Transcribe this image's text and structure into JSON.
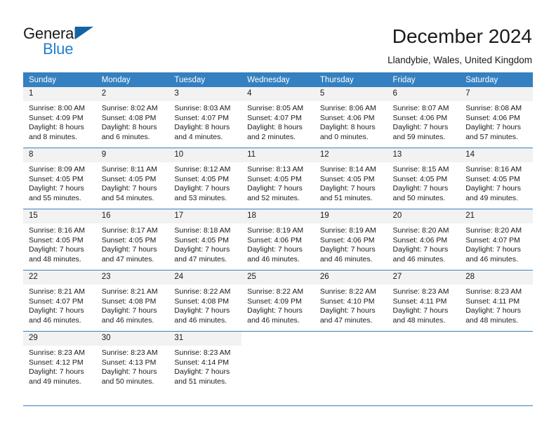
{
  "brand": {
    "line1": "General",
    "line2": "Blue",
    "flag_color": "#1464a5",
    "line2_color": "#1f7fd0"
  },
  "header": {
    "title": "December 2024",
    "subtitle": "Llandybie, Wales, United Kingdom"
  },
  "calendar": {
    "header_bg": "#3580c0",
    "daynum_bg": "#f2f2f2",
    "weekday_headers": [
      "Sunday",
      "Monday",
      "Tuesday",
      "Wednesday",
      "Thursday",
      "Friday",
      "Saturday"
    ],
    "weeks": [
      [
        {
          "day": "1",
          "sunrise": "Sunrise: 8:00 AM",
          "sunset": "Sunset: 4:09 PM",
          "daylight1": "Daylight: 8 hours",
          "daylight2": "and 8 minutes."
        },
        {
          "day": "2",
          "sunrise": "Sunrise: 8:02 AM",
          "sunset": "Sunset: 4:08 PM",
          "daylight1": "Daylight: 8 hours",
          "daylight2": "and 6 minutes."
        },
        {
          "day": "3",
          "sunrise": "Sunrise: 8:03 AM",
          "sunset": "Sunset: 4:07 PM",
          "daylight1": "Daylight: 8 hours",
          "daylight2": "and 4 minutes."
        },
        {
          "day": "4",
          "sunrise": "Sunrise: 8:05 AM",
          "sunset": "Sunset: 4:07 PM",
          "daylight1": "Daylight: 8 hours",
          "daylight2": "and 2 minutes."
        },
        {
          "day": "5",
          "sunrise": "Sunrise: 8:06 AM",
          "sunset": "Sunset: 4:06 PM",
          "daylight1": "Daylight: 8 hours",
          "daylight2": "and 0 minutes."
        },
        {
          "day": "6",
          "sunrise": "Sunrise: 8:07 AM",
          "sunset": "Sunset: 4:06 PM",
          "daylight1": "Daylight: 7 hours",
          "daylight2": "and 59 minutes."
        },
        {
          "day": "7",
          "sunrise": "Sunrise: 8:08 AM",
          "sunset": "Sunset: 4:06 PM",
          "daylight1": "Daylight: 7 hours",
          "daylight2": "and 57 minutes."
        }
      ],
      [
        {
          "day": "8",
          "sunrise": "Sunrise: 8:09 AM",
          "sunset": "Sunset: 4:05 PM",
          "daylight1": "Daylight: 7 hours",
          "daylight2": "and 55 minutes."
        },
        {
          "day": "9",
          "sunrise": "Sunrise: 8:11 AM",
          "sunset": "Sunset: 4:05 PM",
          "daylight1": "Daylight: 7 hours",
          "daylight2": "and 54 minutes."
        },
        {
          "day": "10",
          "sunrise": "Sunrise: 8:12 AM",
          "sunset": "Sunset: 4:05 PM",
          "daylight1": "Daylight: 7 hours",
          "daylight2": "and 53 minutes."
        },
        {
          "day": "11",
          "sunrise": "Sunrise: 8:13 AM",
          "sunset": "Sunset: 4:05 PM",
          "daylight1": "Daylight: 7 hours",
          "daylight2": "and 52 minutes."
        },
        {
          "day": "12",
          "sunrise": "Sunrise: 8:14 AM",
          "sunset": "Sunset: 4:05 PM",
          "daylight1": "Daylight: 7 hours",
          "daylight2": "and 51 minutes."
        },
        {
          "day": "13",
          "sunrise": "Sunrise: 8:15 AM",
          "sunset": "Sunset: 4:05 PM",
          "daylight1": "Daylight: 7 hours",
          "daylight2": "and 50 minutes."
        },
        {
          "day": "14",
          "sunrise": "Sunrise: 8:16 AM",
          "sunset": "Sunset: 4:05 PM",
          "daylight1": "Daylight: 7 hours",
          "daylight2": "and 49 minutes."
        }
      ],
      [
        {
          "day": "15",
          "sunrise": "Sunrise: 8:16 AM",
          "sunset": "Sunset: 4:05 PM",
          "daylight1": "Daylight: 7 hours",
          "daylight2": "and 48 minutes."
        },
        {
          "day": "16",
          "sunrise": "Sunrise: 8:17 AM",
          "sunset": "Sunset: 4:05 PM",
          "daylight1": "Daylight: 7 hours",
          "daylight2": "and 47 minutes."
        },
        {
          "day": "17",
          "sunrise": "Sunrise: 8:18 AM",
          "sunset": "Sunset: 4:05 PM",
          "daylight1": "Daylight: 7 hours",
          "daylight2": "and 47 minutes."
        },
        {
          "day": "18",
          "sunrise": "Sunrise: 8:19 AM",
          "sunset": "Sunset: 4:06 PM",
          "daylight1": "Daylight: 7 hours",
          "daylight2": "and 46 minutes."
        },
        {
          "day": "19",
          "sunrise": "Sunrise: 8:19 AM",
          "sunset": "Sunset: 4:06 PM",
          "daylight1": "Daylight: 7 hours",
          "daylight2": "and 46 minutes."
        },
        {
          "day": "20",
          "sunrise": "Sunrise: 8:20 AM",
          "sunset": "Sunset: 4:06 PM",
          "daylight1": "Daylight: 7 hours",
          "daylight2": "and 46 minutes."
        },
        {
          "day": "21",
          "sunrise": "Sunrise: 8:20 AM",
          "sunset": "Sunset: 4:07 PM",
          "daylight1": "Daylight: 7 hours",
          "daylight2": "and 46 minutes."
        }
      ],
      [
        {
          "day": "22",
          "sunrise": "Sunrise: 8:21 AM",
          "sunset": "Sunset: 4:07 PM",
          "daylight1": "Daylight: 7 hours",
          "daylight2": "and 46 minutes."
        },
        {
          "day": "23",
          "sunrise": "Sunrise: 8:21 AM",
          "sunset": "Sunset: 4:08 PM",
          "daylight1": "Daylight: 7 hours",
          "daylight2": "and 46 minutes."
        },
        {
          "day": "24",
          "sunrise": "Sunrise: 8:22 AM",
          "sunset": "Sunset: 4:08 PM",
          "daylight1": "Daylight: 7 hours",
          "daylight2": "and 46 minutes."
        },
        {
          "day": "25",
          "sunrise": "Sunrise: 8:22 AM",
          "sunset": "Sunset: 4:09 PM",
          "daylight1": "Daylight: 7 hours",
          "daylight2": "and 46 minutes."
        },
        {
          "day": "26",
          "sunrise": "Sunrise: 8:22 AM",
          "sunset": "Sunset: 4:10 PM",
          "daylight1": "Daylight: 7 hours",
          "daylight2": "and 47 minutes."
        },
        {
          "day": "27",
          "sunrise": "Sunrise: 8:23 AM",
          "sunset": "Sunset: 4:11 PM",
          "daylight1": "Daylight: 7 hours",
          "daylight2": "and 48 minutes."
        },
        {
          "day": "28",
          "sunrise": "Sunrise: 8:23 AM",
          "sunset": "Sunset: 4:11 PM",
          "daylight1": "Daylight: 7 hours",
          "daylight2": "and 48 minutes."
        }
      ],
      [
        {
          "day": "29",
          "sunrise": "Sunrise: 8:23 AM",
          "sunset": "Sunset: 4:12 PM",
          "daylight1": "Daylight: 7 hours",
          "daylight2": "and 49 minutes."
        },
        {
          "day": "30",
          "sunrise": "Sunrise: 8:23 AM",
          "sunset": "Sunset: 4:13 PM",
          "daylight1": "Daylight: 7 hours",
          "daylight2": "and 50 minutes."
        },
        {
          "day": "31",
          "sunrise": "Sunrise: 8:23 AM",
          "sunset": "Sunset: 4:14 PM",
          "daylight1": "Daylight: 7 hours",
          "daylight2": "and 51 minutes."
        },
        {
          "day": "",
          "sunrise": "",
          "sunset": "",
          "daylight1": "",
          "daylight2": ""
        },
        {
          "day": "",
          "sunrise": "",
          "sunset": "",
          "daylight1": "",
          "daylight2": ""
        },
        {
          "day": "",
          "sunrise": "",
          "sunset": "",
          "daylight1": "",
          "daylight2": ""
        },
        {
          "day": "",
          "sunrise": "",
          "sunset": "",
          "daylight1": "",
          "daylight2": ""
        }
      ]
    ]
  }
}
